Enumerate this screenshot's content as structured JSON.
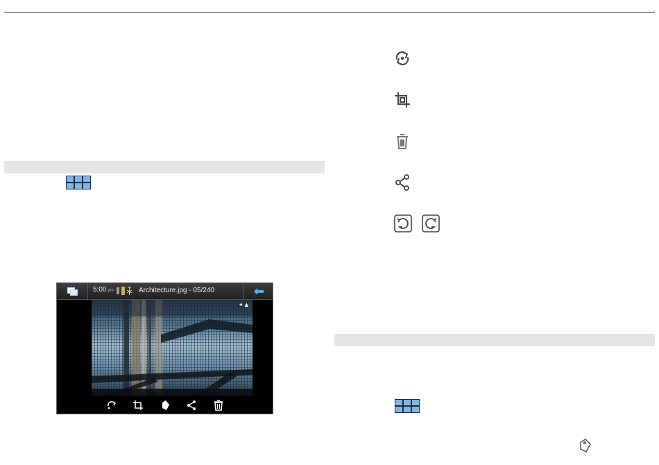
{
  "device": {
    "time": "5:00",
    "ampm": "pm",
    "file_title": "Architecture.jpg - 05/240",
    "photo_marks": "★ ▲"
  },
  "icons": {
    "grid": "grid-view-icon",
    "rotate": "rotate-icon",
    "crop": "crop-icon",
    "delete": "trash-icon",
    "share": "share-icon",
    "undo": "undo-icon",
    "redo": "redo-icon",
    "tag": "tag-icon",
    "back": "back-arrow-icon"
  },
  "colors": {
    "band": "#e5e5e5",
    "grid_dark": "#1a2b3e",
    "grid_light": "#7fb7e3",
    "accent_back": "#4ab3f4"
  }
}
